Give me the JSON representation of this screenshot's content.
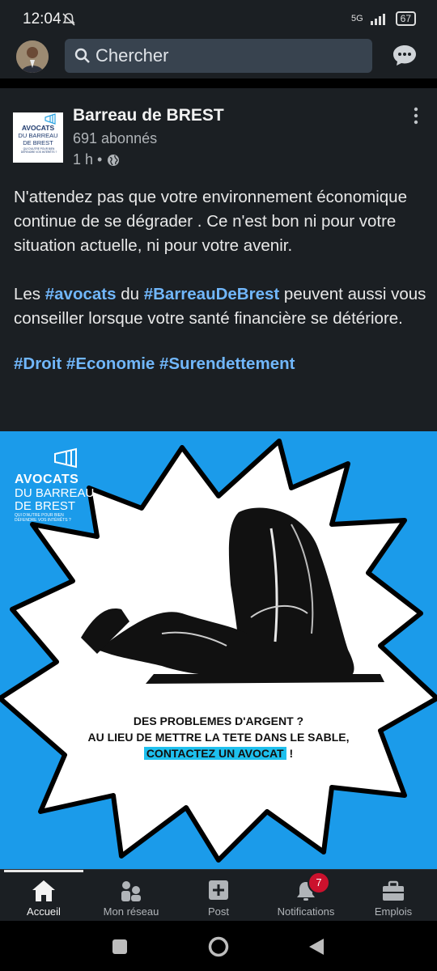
{
  "status": {
    "time": "12:04",
    "network": "5G",
    "battery": "67"
  },
  "search": {
    "placeholder": "Chercher"
  },
  "post": {
    "author": "Barreau de BREST",
    "followers": "691 abonnés",
    "time": "1 h •",
    "logo": {
      "line1": "AVOCATS",
      "line2": "DU BARREAU",
      "line3": "DE BREST",
      "line4": "QUI D'AUTRE POUR BIEN DÉFENDRE VOS INTÉRÊTS ?"
    },
    "paragraph1": "N'attendez pas que votre environnement économique continue de se dégrader . Ce n'est bon ni pour votre situation actuelle, ni pour votre avenir.",
    "paragraph2": {
      "p1": "Les ",
      "tag1": "#avocats",
      "p2": " du ",
      "tag2": "#BarreauDeBrest",
      "p3": " peuvent aussi vous conseiller lorsque votre santé financière se détériore."
    },
    "hashtags": "#Droit #Economie #Surendettement",
    "image": {
      "logo_line1": "AVOCATS",
      "logo_line2": "DU BARREAU",
      "logo_line3": "DE BREST",
      "logo_line4": "QUI D'AUTRE POUR BIEN DÉFENDRE VOS INTÉRÊTS ?",
      "caption_line1": "DES PROBLEMES D'ARGENT ?",
      "caption_line2": "AU LIEU DE METTRE LA TETE DANS LE SABLE,",
      "caption_highlight": "CONTACTEZ UN AVOCAT",
      "caption_end": " !",
      "background_color": "#1b9bea"
    }
  },
  "nav": {
    "home": "Accueil",
    "network": "Mon réseau",
    "post": "Post",
    "notifications": "Notifications",
    "notifications_badge": "7",
    "jobs": "Emplois"
  }
}
